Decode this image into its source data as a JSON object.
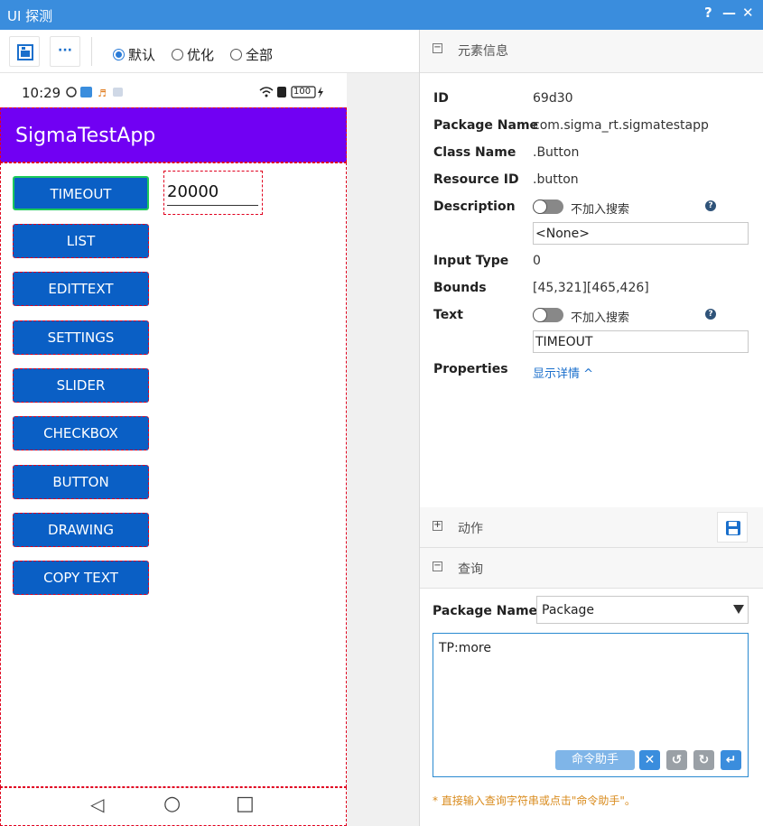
{
  "window": {
    "title": "UI 探测",
    "help_label": "?",
    "minimize_label": "—",
    "close_label": "✕"
  },
  "toolbar": {
    "screenshot_icon": "screenshot-icon",
    "more_label": "···",
    "view_modes": [
      {
        "label": "默认",
        "selected": true
      },
      {
        "label": "优化",
        "selected": false
      },
      {
        "label": "全部",
        "selected": false
      }
    ]
  },
  "device": {
    "status_time": "10:29",
    "battery": "100",
    "app_title": "SigmaTestApp",
    "buttons": [
      "TIMEOUT",
      "LIST",
      "EDITTEXT",
      "SETTINGS",
      "SLIDER",
      "CHECKBOX",
      "BUTTON",
      "DRAWING",
      "COPY TEXT"
    ],
    "selected_button_index": 0,
    "number_field_value": "20000",
    "nav": {
      "back": "◁",
      "home": "○",
      "recents": "□"
    }
  },
  "colors": {
    "accent": "#3a8ddd",
    "app_bar": "#7100f3",
    "button": "#0a5fc5",
    "highlight": "#1ec95a",
    "outline": "#e0001f"
  },
  "element_info": {
    "section_title": "元素信息",
    "collapse_label": "−",
    "id_label": "ID",
    "id_value": "69d30",
    "package_label": "Package Name",
    "package_value": "com.sigma_rt.sigmatestapp",
    "class_label": "Class Name",
    "class_value": ".Button",
    "resource_label": "Resource ID",
    "resource_value": ".button",
    "description_label": "Description",
    "description_toggle_label": "不加入搜索",
    "description_value": "<None>",
    "input_type_label": "Input Type",
    "input_type_value": "0",
    "bounds_label": "Bounds",
    "bounds_value": "[45,321][465,426]",
    "text_label": "Text",
    "text_toggle_label": "不加入搜索",
    "text_value": "TIMEOUT",
    "properties_label": "Properties",
    "properties_link": "显示详情 ^",
    "help_glyph": "?"
  },
  "actions": {
    "section_title": "动作",
    "expand_label": "+"
  },
  "query": {
    "section_title": "查询",
    "collapse_label": "−",
    "package_label": "Package Name",
    "package_select": "Package",
    "query_text": "TP:more",
    "assistant_button": "命令助手",
    "hint": "* 直接输入查询字符串或点击\"命令助手\"。"
  }
}
